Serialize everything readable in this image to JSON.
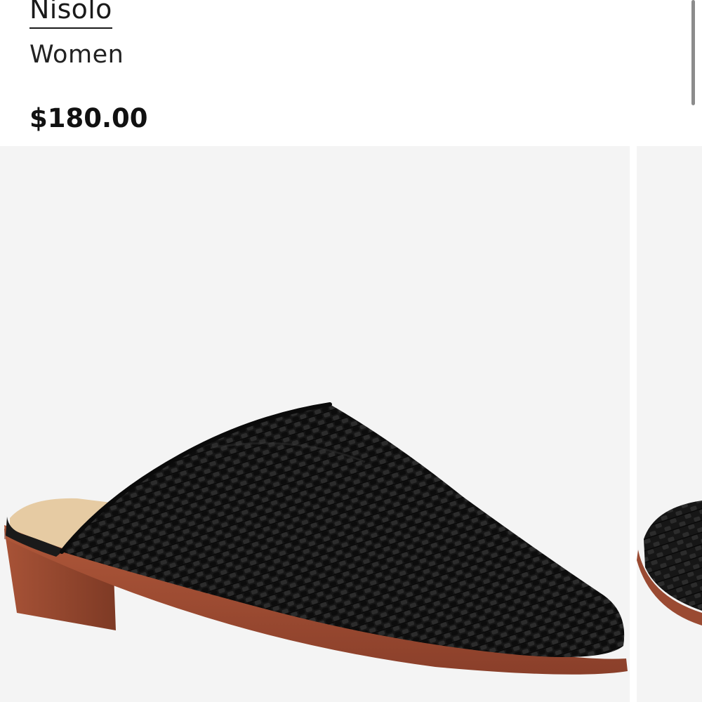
{
  "product": {
    "brand": "Nisolo",
    "category": "Women",
    "price": "$180.00"
  },
  "gallery": {
    "images": [
      {
        "name": "black-woven-mule-main-photo"
      },
      {
        "name": "black-woven-mule-next-photo"
      }
    ]
  },
  "colors": {
    "background": "#ffffff",
    "image_background": "#f4f4f4",
    "shoe_leather": "#141414",
    "sole": "#9a4a32",
    "insole": "#e8cfa8"
  }
}
